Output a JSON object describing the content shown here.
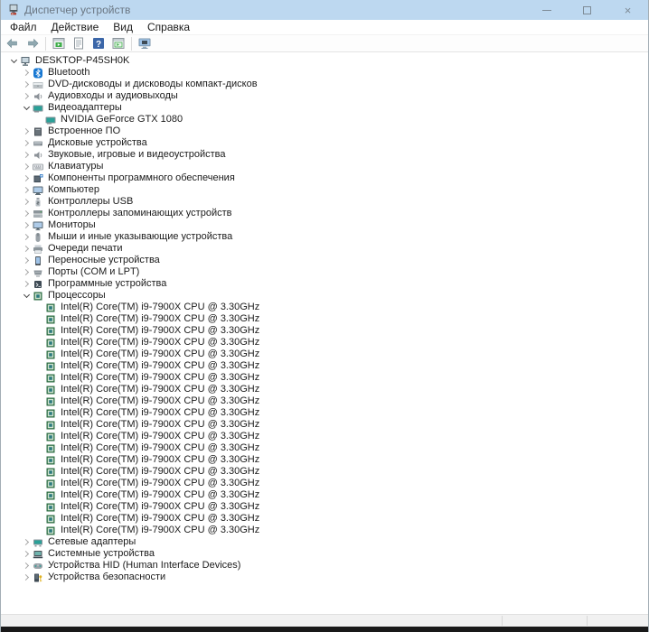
{
  "window": {
    "title": "Диспетчер устройств",
    "controls": [
      {
        "name": "minimize-button",
        "icon": "minimize"
      },
      {
        "name": "maximize-button",
        "icon": "maximize"
      },
      {
        "name": "close-button",
        "icon": "close"
      }
    ]
  },
  "menu": {
    "items": [
      {
        "id": "file",
        "label": "Файл"
      },
      {
        "id": "action",
        "label": "Действие"
      },
      {
        "id": "view",
        "label": "Вид"
      },
      {
        "id": "help",
        "label": "Справка"
      }
    ]
  },
  "toolbar": {
    "items": [
      {
        "icon": "back",
        "name": "back-button"
      },
      {
        "icon": "forward",
        "name": "forward-button"
      },
      {
        "separator": true
      },
      {
        "icon": "console-tree",
        "name": "console-tree-button"
      },
      {
        "icon": "properties",
        "name": "properties-button"
      },
      {
        "icon": "help",
        "name": "help-button"
      },
      {
        "icon": "action-pane",
        "name": "action-pane-button"
      },
      {
        "separator": true
      },
      {
        "icon": "scan-hardware",
        "name": "scan-hardware-button"
      }
    ]
  },
  "tree": {
    "items": [
      {
        "depth": 0,
        "state": "expanded",
        "icon": "computer",
        "label": "DESKTOP-P45SH0K"
      },
      {
        "depth": 1,
        "state": "collapsed",
        "icon": "bluetooth",
        "label": "Bluetooth"
      },
      {
        "depth": 1,
        "state": "collapsed",
        "icon": "dvd-drive",
        "label": "DVD-дисководы и дисководы компакт-дисков"
      },
      {
        "depth": 1,
        "state": "collapsed",
        "icon": "audio",
        "label": "Аудиовходы и аудиовыходы"
      },
      {
        "depth": 1,
        "state": "expanded",
        "icon": "gpu",
        "label": "Видеоадаптеры"
      },
      {
        "depth": 2,
        "state": "leaf",
        "icon": "gpu",
        "label": "NVIDIA GeForce GTX 1080"
      },
      {
        "depth": 1,
        "state": "collapsed",
        "icon": "firmware",
        "label": "Встроенное ПО"
      },
      {
        "depth": 1,
        "state": "collapsed",
        "icon": "disk-drive",
        "label": "Дисковые устройства"
      },
      {
        "depth": 1,
        "state": "collapsed",
        "icon": "sound",
        "label": "Звуковые, игровые и видеоустройства"
      },
      {
        "depth": 1,
        "state": "collapsed",
        "icon": "keyboard",
        "label": "Клавиатуры"
      },
      {
        "depth": 1,
        "state": "collapsed",
        "icon": "software-component",
        "label": "Компоненты программного обеспечения"
      },
      {
        "depth": 1,
        "state": "collapsed",
        "icon": "monitor-pc",
        "label": "Компьютер"
      },
      {
        "depth": 1,
        "state": "collapsed",
        "icon": "usb",
        "label": "Контроллеры USB"
      },
      {
        "depth": 1,
        "state": "collapsed",
        "icon": "storage-controller",
        "label": "Контроллеры запоминающих устройств"
      },
      {
        "depth": 1,
        "state": "collapsed",
        "icon": "monitor",
        "label": "Мониторы"
      },
      {
        "depth": 1,
        "state": "collapsed",
        "icon": "mouse",
        "label": "Мыши и иные указывающие устройства"
      },
      {
        "depth": 1,
        "state": "collapsed",
        "icon": "print-queue",
        "label": "Очереди печати"
      },
      {
        "depth": 1,
        "state": "collapsed",
        "icon": "portable",
        "label": "Переносные устройства"
      },
      {
        "depth": 1,
        "state": "collapsed",
        "icon": "ports",
        "label": "Порты (COM и LPT)"
      },
      {
        "depth": 1,
        "state": "collapsed",
        "icon": "software-device",
        "label": "Программные устройства"
      },
      {
        "depth": 1,
        "state": "expanded",
        "icon": "cpu",
        "label": "Процессоры"
      },
      {
        "depth": 2,
        "state": "leaf",
        "icon": "cpu",
        "label": "Intel(R) Core(TM) i9-7900X CPU @ 3.30GHz"
      },
      {
        "depth": 2,
        "state": "leaf",
        "icon": "cpu",
        "label": "Intel(R) Core(TM) i9-7900X CPU @ 3.30GHz"
      },
      {
        "depth": 2,
        "state": "leaf",
        "icon": "cpu",
        "label": "Intel(R) Core(TM) i9-7900X CPU @ 3.30GHz"
      },
      {
        "depth": 2,
        "state": "leaf",
        "icon": "cpu",
        "label": "Intel(R) Core(TM) i9-7900X CPU @ 3.30GHz"
      },
      {
        "depth": 2,
        "state": "leaf",
        "icon": "cpu",
        "label": "Intel(R) Core(TM) i9-7900X CPU @ 3.30GHz"
      },
      {
        "depth": 2,
        "state": "leaf",
        "icon": "cpu",
        "label": "Intel(R) Core(TM) i9-7900X CPU @ 3.30GHz"
      },
      {
        "depth": 2,
        "state": "leaf",
        "icon": "cpu",
        "label": "Intel(R) Core(TM) i9-7900X CPU @ 3.30GHz"
      },
      {
        "depth": 2,
        "state": "leaf",
        "icon": "cpu",
        "label": "Intel(R) Core(TM) i9-7900X CPU @ 3.30GHz"
      },
      {
        "depth": 2,
        "state": "leaf",
        "icon": "cpu",
        "label": "Intel(R) Core(TM) i9-7900X CPU @ 3.30GHz"
      },
      {
        "depth": 2,
        "state": "leaf",
        "icon": "cpu",
        "label": "Intel(R) Core(TM) i9-7900X CPU @ 3.30GHz"
      },
      {
        "depth": 2,
        "state": "leaf",
        "icon": "cpu",
        "label": "Intel(R) Core(TM) i9-7900X CPU @ 3.30GHz"
      },
      {
        "depth": 2,
        "state": "leaf",
        "icon": "cpu",
        "label": "Intel(R) Core(TM) i9-7900X CPU @ 3.30GHz"
      },
      {
        "depth": 2,
        "state": "leaf",
        "icon": "cpu",
        "label": "Intel(R) Core(TM) i9-7900X CPU @ 3.30GHz"
      },
      {
        "depth": 2,
        "state": "leaf",
        "icon": "cpu",
        "label": "Intel(R) Core(TM) i9-7900X CPU @ 3.30GHz"
      },
      {
        "depth": 2,
        "state": "leaf",
        "icon": "cpu",
        "label": "Intel(R) Core(TM) i9-7900X CPU @ 3.30GHz"
      },
      {
        "depth": 2,
        "state": "leaf",
        "icon": "cpu",
        "label": "Intel(R) Core(TM) i9-7900X CPU @ 3.30GHz"
      },
      {
        "depth": 2,
        "state": "leaf",
        "icon": "cpu",
        "label": "Intel(R) Core(TM) i9-7900X CPU @ 3.30GHz"
      },
      {
        "depth": 2,
        "state": "leaf",
        "icon": "cpu",
        "label": "Intel(R) Core(TM) i9-7900X CPU @ 3.30GHz"
      },
      {
        "depth": 2,
        "state": "leaf",
        "icon": "cpu",
        "label": "Intel(R) Core(TM) i9-7900X CPU @ 3.30GHz"
      },
      {
        "depth": 2,
        "state": "leaf",
        "icon": "cpu",
        "label": "Intel(R) Core(TM) i9-7900X CPU @ 3.30GHz"
      },
      {
        "depth": 1,
        "state": "collapsed",
        "icon": "network",
        "label": "Сетевые адаптеры"
      },
      {
        "depth": 1,
        "state": "collapsed",
        "icon": "system",
        "label": "Системные устройства"
      },
      {
        "depth": 1,
        "state": "collapsed",
        "icon": "hid",
        "label": "Устройства HID (Human Interface Devices)"
      },
      {
        "depth": 1,
        "state": "collapsed",
        "icon": "security",
        "label": "Устройства безопасности"
      }
    ]
  },
  "colors": {
    "titlebar": "#bdd8f0",
    "help_blue": "#3b66a8",
    "cpu_green": "#2e6e44",
    "screen_teal": "#2aa198",
    "status_bg": "#f1f1f1"
  }
}
